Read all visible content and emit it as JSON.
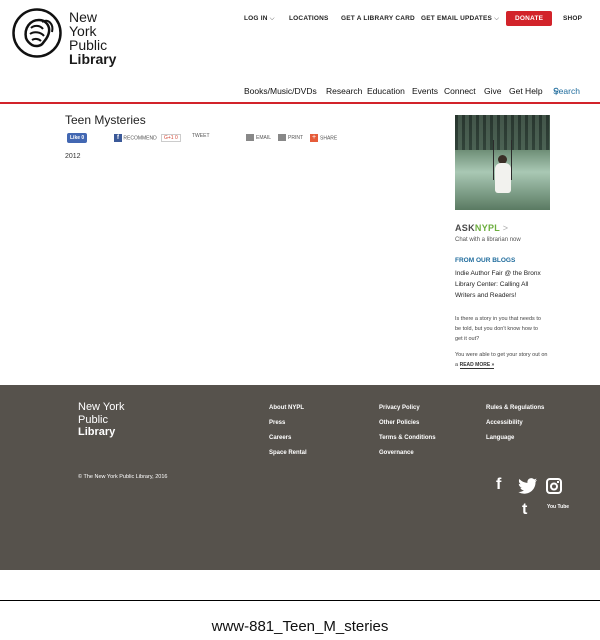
{
  "header": {
    "logo_line1": "New York",
    "logo_line2": "Public",
    "logo_line3": "Library",
    "top_nav": {
      "login": "LOG IN",
      "locations": "LOCATIONS",
      "library_card": "GET A LIBRARY CARD",
      "email_updates": "GET EMAIL UPDATES",
      "donate": "DONATE",
      "shop": "SHOP"
    },
    "main_nav": [
      "Books/Music/DVDs",
      "Research",
      "Education",
      "Events",
      "Connect",
      "Give",
      "Get Help",
      "Search"
    ],
    "accent_color": "#d2232a"
  },
  "content": {
    "title": "Teen Mysteries",
    "social": {
      "like": "Like 0",
      "recommend": "RECOMMEND",
      "gplus": "G+1 0",
      "tweet": "TWEET",
      "email": "EMAIL",
      "print": "PRINT",
      "share": "SHARE"
    },
    "year": "2012"
  },
  "sidebar": {
    "ask_part1": "ASK",
    "ask_part2": "NYPL",
    "ask_arrow": ">",
    "chat_text": "Chat with a librarian now",
    "blogs_heading": "FROM OUR BLOGS",
    "blog_title": "Indie Author Fair @ the Bronx Library Center: Calling All Writers and Readers!",
    "blog_excerpt1": "Is there a story in you that needs to be told, but you don't know how to get it out?",
    "blog_excerpt2": "You were able to get your story out on a",
    "read_more": "READ MORE »"
  },
  "footer": {
    "logo_line1": "New York",
    "logo_line2": "Public",
    "logo_line3": "Library",
    "col1": [
      "About NYPL",
      "Press",
      "Careers",
      "Space Rental"
    ],
    "col2": [
      "Privacy Policy",
      "Other Policies",
      "Terms & Conditions",
      "Governance"
    ],
    "col3": [
      "Rules & Regulations",
      "Accessibility",
      "Language"
    ],
    "copyright": "© The New York Public Library, 2016",
    "social_icons": [
      "facebook-icon",
      "twitter-icon",
      "instagram-icon",
      "tumblr-icon",
      "youtube-icon"
    ],
    "youtube_text": "You Tube",
    "background": "#56524c"
  },
  "caption": "www-881_Teen_M_steries"
}
